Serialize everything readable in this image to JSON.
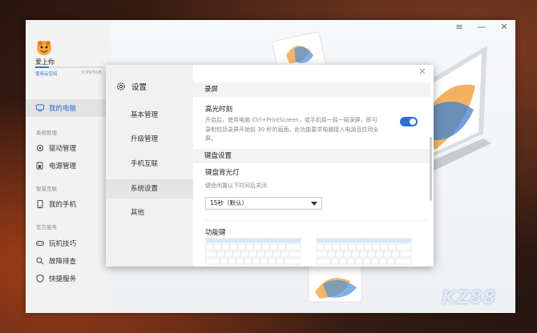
{
  "app": {
    "user": {
      "name": "爱上你",
      "cloud_link": "使用云空间",
      "cloud_usage": "0.99/5GB",
      "cloud_fraction": 0.2
    },
    "nav": {
      "my_pc": "我的电脑",
      "group_system": "系统管理",
      "driver": "驱动管理",
      "power": "电源管理",
      "group_smart": "智慧互联",
      "my_phone": "我的手机",
      "group_service": "官方服务",
      "tips": "玩机技巧",
      "troubleshoot": "故障排查",
      "quick_service": "快捷服务"
    },
    "watermark": "KZ88",
    "window_controls": [
      "≡",
      "—",
      "✕"
    ]
  },
  "dialog": {
    "title": "设置",
    "close": "✕",
    "tabs": [
      "基本管理",
      "升级管理",
      "手机互联",
      "系统设置",
      "其他"
    ],
    "active_tab": 3,
    "sections": {
      "record": {
        "header": "录屏",
        "highlight_title": "高光时刻",
        "highlight_desc": "开启后，使用电脑 Ctrl+PrintScreen，或手机摇一摇一碰录屏，即可录制包括录屏开始前 30 秒的画面。此功能要求电脑接入电源且应用全屏。",
        "highlight_enabled": true
      },
      "keyboard": {
        "header": "键盘设置",
        "backlight_title": "键盘背光灯",
        "backlight_desc": "键盘闲置以下时间后关闭",
        "backlight_value": "15秒（默认）",
        "fn_title": "功能键"
      }
    }
  },
  "colors": {
    "accent": "#2e6fd1"
  }
}
